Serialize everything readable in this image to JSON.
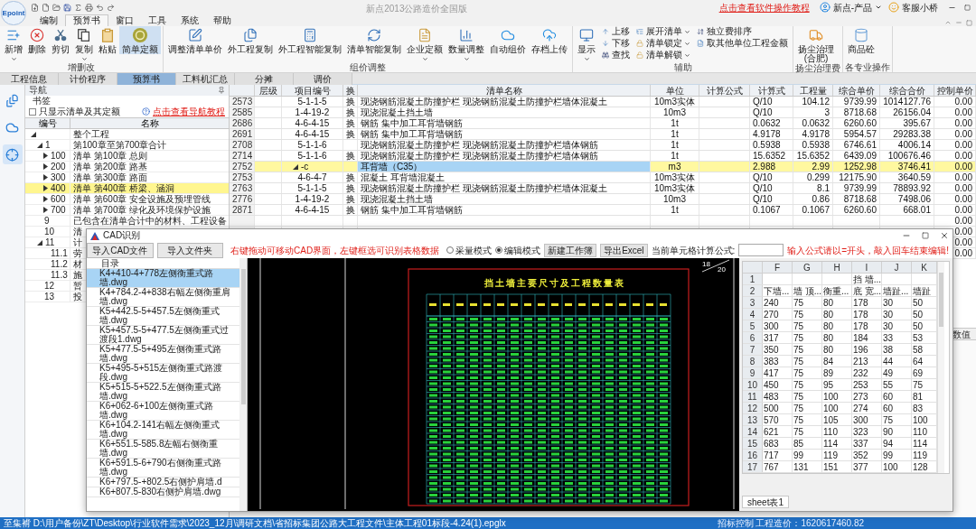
{
  "window": {
    "logo": "Epoint",
    "title": "新点2013公路造价全国版",
    "help_link": "点击查看软件操作教程",
    "user": "新点-产品",
    "service": "客服小桥"
  },
  "menu": [
    {
      "label": "编制",
      "selected": false
    },
    {
      "label": "预算书",
      "selected": true
    },
    {
      "label": "窗口",
      "selected": false
    },
    {
      "label": "工具",
      "selected": false
    },
    {
      "label": "系统",
      "selected": false
    },
    {
      "label": "帮助",
      "selected": false
    }
  ],
  "ribbon": {
    "groups": [
      {
        "label": "增删改",
        "buttons": [
          {
            "label": "新增",
            "kind": "large",
            "dropdown": true,
            "selected": false
          },
          {
            "label": "删除",
            "kind": "large",
            "dropdown": false,
            "selected": false
          },
          {
            "label": "剪切",
            "kind": "large",
            "dropdown": false,
            "selected": false
          },
          {
            "label": "复制",
            "kind": "large",
            "dropdown": true,
            "selected": false
          },
          {
            "label": "粘贴",
            "kind": "large",
            "dropdown": false,
            "selected": false
          },
          {
            "label": "简单定额",
            "kind": "large",
            "dropdown": false,
            "selected": true
          }
        ]
      },
      {
        "label": "组价调整",
        "buttons": [
          {
            "label": "调整清单单价",
            "kind": "large",
            "dropdown": false,
            "selected": false
          },
          {
            "label": "外工程复制",
            "kind": "large",
            "dropdown": false,
            "selected": false
          },
          {
            "label": "外工程智能复制",
            "kind": "large",
            "dropdown": false,
            "selected": false
          },
          {
            "label": "清单智能复制",
            "kind": "large",
            "dropdown": false,
            "selected": false
          },
          {
            "label": "企业定额",
            "kind": "large",
            "dropdown": true,
            "selected": false
          },
          {
            "label": "数量调整",
            "kind": "large",
            "dropdown": true,
            "selected": false
          },
          {
            "label": "自动组价",
            "kind": "large",
            "dropdown": false,
            "selected": false
          },
          {
            "label": "存档上传",
            "kind": "large",
            "dropdown": false,
            "selected": false
          }
        ]
      },
      {
        "label": "辅助",
        "buttons": [
          {
            "label": "显示",
            "kind": "large",
            "dropdown": true,
            "selected": false
          },
          {
            "label": "上移",
            "kind": "small",
            "dropdown": false,
            "selected": false
          },
          {
            "label": "下移",
            "kind": "small",
            "dropdown": false,
            "selected": false
          },
          {
            "label": "查找",
            "kind": "small",
            "dropdown": false,
            "selected": false
          },
          {
            "label": "展开清单",
            "kind": "small",
            "dropdown": true,
            "selected": false
          },
          {
            "label": "清单锁定",
            "kind": "small",
            "dropdown": true,
            "selected": false
          },
          {
            "label": "清单解锁",
            "kind": "small",
            "dropdown": true,
            "selected": false
          },
          {
            "label": "独立费排序",
            "kind": "small",
            "dropdown": false,
            "selected": false
          },
          {
            "label": "取其他单位工程金额",
            "kind": "small",
            "dropdown": false,
            "selected": false
          }
        ]
      },
      {
        "label": "扬尘治理费",
        "buttons": [
          {
            "label": "扬尘治理(合肥)",
            "kind": "large",
            "dropdown": false,
            "selected": false
          }
        ]
      },
      {
        "label": "各专业操作",
        "buttons": [
          {
            "label": "商品砼",
            "kind": "large",
            "dropdown": false,
            "selected": false
          }
        ]
      }
    ]
  },
  "view_tabs": [
    {
      "label": "工程信息",
      "selected": false
    },
    {
      "label": "计价程序",
      "selected": false
    },
    {
      "label": "预算书",
      "selected": true
    },
    {
      "label": "工料机汇总",
      "selected": false
    },
    {
      "label": "分摊",
      "selected": false
    },
    {
      "label": "调价",
      "selected": false
    }
  ],
  "side_icons": [
    {
      "selected": false
    },
    {
      "selected": false
    },
    {
      "selected": true
    }
  ],
  "navigator": {
    "title": "导航",
    "bookmark": "书签",
    "filter": {
      "label": "只显示清单及其定额",
      "checked": false
    },
    "help_link": "点击查看导航教程",
    "columns": [
      "编号",
      "名称"
    ],
    "tree": [
      {
        "name": "整个工程",
        "expanded": true,
        "selected": false,
        "children": [
          {
            "code": "1",
            "name": "第100章至第700章合计",
            "expanded": true,
            "selected": false,
            "children": [
              {
                "code": "100",
                "name": "清单 第100章 总则",
                "expanded": false,
                "selected": false
              },
              {
                "code": "200",
                "name": "清单 第200章 路基",
                "expanded": false,
                "selected": false
              },
              {
                "code": "300",
                "name": "清单 第300章 路面",
                "expanded": false,
                "selected": false
              },
              {
                "code": "400",
                "name": "清单 第400章 桥梁、涵洞",
                "expanded": false,
                "selected": true
              },
              {
                "code": "600",
                "name": "清单 第600章 安全设施及预埋管线",
                "expanded": false,
                "selected": false
              },
              {
                "code": "700",
                "name": "清单 第700章 绿化及环境保护设施",
                "expanded": false,
                "selected": false
              }
            ]
          },
          {
            "code": "9",
            "name": "已包含在清单合计中的材料、工程设备",
            "selected": false
          },
          {
            "code": "10",
            "name": "清",
            "selected": false
          },
          {
            "code": "11",
            "name": "计",
            "expanded": true,
            "selected": false,
            "children": [
              {
                "code": "11.1",
                "name": "劳",
                "selected": false
              },
              {
                "code": "11.2",
                "name": "材",
                "selected": false
              },
              {
                "code": "11.3",
                "name": "施",
                "selected": false
              }
            ]
          },
          {
            "code": "12",
            "name": "暂",
            "selected": false
          },
          {
            "code": "13",
            "name": "投",
            "selected": false
          }
        ]
      }
    ]
  },
  "table": {
    "columns": [
      "层级",
      "项目编号",
      "换",
      "清单名称",
      "单位",
      "计算公式",
      "计算式",
      "工程量",
      "综合单价",
      "综合合价",
      "控制单价"
    ],
    "rows": [
      {
        "no": "2573",
        "code": "5-1-1-5",
        "swap": "换",
        "name": "现浇钢筋混凝土防撞护栏 现浇钢筋混凝土防撞护栏墙体混凝土",
        "unit": "10m3实体",
        "calc": "Q/10",
        "quantity": "104.12",
        "unit_price": "9739.99",
        "total": "1014127.76",
        "control_price": "0.00",
        "selected": false
      },
      {
        "no": "2585",
        "code": "1-4-19-2",
        "swap": "换",
        "name": "现浇混凝土挡土墙",
        "unit": "10m3",
        "calc": "Q/10",
        "quantity": "3",
        "unit_price": "8718.68",
        "total": "26156.04",
        "control_price": "0.00",
        "selected": false
      },
      {
        "no": "2686",
        "code": "4-6-4-15",
        "swap": "换",
        "name": "钢筋 集中加工耳背墙钢筋",
        "unit": "1t",
        "calc": "0.0632",
        "quantity": "0.0632",
        "unit_price": "6260.60",
        "total": "395.67",
        "control_price": "0.00",
        "selected": false
      },
      {
        "no": "2691",
        "code": "4-6-4-15",
        "swap": "换",
        "name": "钢筋 集中加工耳背墙钢筋",
        "unit": "1t",
        "calc": "4.9178",
        "quantity": "4.9178",
        "unit_price": "5954.57",
        "total": "29283.38",
        "control_price": "0.00",
        "selected": false
      },
      {
        "no": "2708",
        "code": "5-1-1-6",
        "name": "现浇钢筋混凝土防撞护栏 现浇钢筋混凝土防撞护栏墙体钢筋",
        "unit": "1t",
        "calc": "0.5938",
        "quantity": "0.5938",
        "unit_price": "6746.61",
        "total": "4006.14",
        "control_price": "0.00",
        "selected": false
      },
      {
        "no": "2714",
        "code": "5-1-1-6",
        "swap": "换",
        "name": "现浇钢筋混凝土防撞护栏 现浇钢筋混凝土防撞护栏墙体钢筋",
        "unit": "1t",
        "calc": "15.6352",
        "quantity": "15.6352",
        "unit_price": "6439.09",
        "total": "100676.46",
        "control_price": "0.00",
        "selected": false
      },
      {
        "no": "2752",
        "code": "-c",
        "expanded": true,
        "name": "耳背墙（C35）",
        "unit": "m3",
        "calc": "2.988",
        "quantity": "2.99",
        "unit_price": "1252.98",
        "total": "3746.41",
        "control_price": "0.00",
        "selected": true
      },
      {
        "no": "2753",
        "code": "4-6-4-7",
        "swap": "换",
        "name": "混凝土 耳背墙混凝土",
        "unit": "10m3实体",
        "calc": "Q/10",
        "quantity": "0.299",
        "unit_price": "12175.90",
        "total": "3640.59",
        "control_price": "0.00",
        "selected": false
      },
      {
        "no": "2763",
        "code": "5-1-1-5",
        "swap": "换",
        "name": "现浇钢筋混凝土防撞护栏 现浇钢筋混凝土防撞护栏墙体混凝土",
        "unit": "10m3实体",
        "calc": "Q/10",
        "quantity": "8.1",
        "unit_price": "9739.99",
        "total": "78893.92",
        "control_price": "0.00",
        "selected": false
      },
      {
        "no": "2776",
        "code": "1-4-19-2",
        "swap": "换",
        "name": "现浇混凝土挡土墙",
        "unit": "10m3",
        "calc": "Q/10",
        "quantity": "0.86",
        "unit_price": "8718.68",
        "total": "7498.06",
        "control_price": "0.00",
        "selected": false
      },
      {
        "no": "2871",
        "code": "4-6-4-15",
        "swap": "换",
        "name": "钢筋 集中加工耳背墙钢筋",
        "unit": "1t",
        "calc": "0.1067",
        "quantity": "0.1067",
        "unit_price": "6260.60",
        "total": "668.01",
        "control_price": "0.00",
        "selected": false
      },
      {
        "control_price": "0.00",
        "selected": false
      },
      {
        "control_price": "0.00",
        "selected": false
      },
      {
        "control_price": "0.00",
        "selected": false
      },
      {
        "control_price": "0.00",
        "selected": false
      }
    ]
  },
  "lower_panel": {
    "column": "数值"
  },
  "cad_dialog": {
    "title": "CAD识别",
    "import_file": "导入CAD文件",
    "import_folder": "导入文件夹",
    "hint": "右键拖动可移动CAD界面，左键框选可识别表格数据",
    "modes": [
      {
        "label": "采量模式",
        "selected": false
      },
      {
        "label": "编辑模式",
        "selected": true
      }
    ],
    "new_workbook": "新建工作簿",
    "export": "导出Excel",
    "formula_label": "当前单元格计算公式:",
    "formula_hint": "输入公式请以=开头，敲入回车结束编辑!",
    "files_header": "目录",
    "files": [
      {
        "name": "K4+410-4+778左侧衡重式路墙.dwg",
        "selected": true
      },
      {
        "name": "K4+784.2-4+838右幅左侧衡重肩墙.dwg",
        "selected": false
      },
      {
        "name": "K5+442.5-5+457.5左侧衡重式墙.dwg",
        "selected": false
      },
      {
        "name": "K5+457.5-5+477.5左侧衡重式过渡段1.dwg",
        "selected": false
      },
      {
        "name": "K5+477.5-5+495左侧衡重式路墙.dwg",
        "selected": false
      },
      {
        "name": "K5+495-5+515左侧衡重式路渡段.dwg",
        "selected": false
      },
      {
        "name": "K5+515-5+522.5左侧衡重式路墙.dwg",
        "selected": false
      },
      {
        "name": "K6+062-6+100左侧衡重式路墙.dwg",
        "selected": false
      },
      {
        "name": "K6+104.2-141右幅左侧衡重式墙.dwg",
        "selected": false
      },
      {
        "name": "K6+551.5-585.8左幅右侧衡重墙.dwg",
        "selected": false
      },
      {
        "name": "K6+591.5-6+790右侧衡重式路墙.dwg",
        "selected": false
      },
      {
        "name": "K6+797.5-+802.5右侧护肩墙.d",
        "selected": false
      },
      {
        "name": "K6+807.5-830右侧护肩墙.dwg",
        "selected": false
      }
    ],
    "drawing_title": "挡土墙主要尺寸及工程数量表",
    "page_current": "18",
    "page_total": "20",
    "sheet": {
      "columns": [
        "F",
        "G",
        "H",
        "I",
        "J",
        "K"
      ],
      "tab": "sheet表1",
      "rows": [
        {
          "n": "1",
          "cells": [
            null,
            null,
            null,
            "挡 墙...",
            null,
            null
          ]
        },
        {
          "n": "2",
          "cells": [
            "下墙...",
            "墙 顶...",
            "衡重...",
            "底 宽...",
            "墙趾...",
            "墙趾"
          ]
        },
        {
          "n": "3",
          "cells": [
            "240",
            "75",
            "80",
            "178",
            "30",
            "50"
          ]
        },
        {
          "n": "4",
          "cells": [
            "270",
            "75",
            "80",
            "178",
            "30",
            "50"
          ]
        },
        {
          "n": "5",
          "cells": [
            "300",
            "75",
            "80",
            "178",
            "30",
            "50"
          ]
        },
        {
          "n": "6",
          "cells": [
            "317",
            "75",
            "80",
            "184",
            "33",
            "53"
          ]
        },
        {
          "n": "7",
          "cells": [
            "350",
            "75",
            "80",
            "196",
            "38",
            "58"
          ]
        },
        {
          "n": "8",
          "cells": [
            "383",
            "75",
            "84",
            "213",
            "44",
            "64"
          ]
        },
        {
          "n": "9",
          "cells": [
            "417",
            "75",
            "89",
            "232",
            "49",
            "69"
          ]
        },
        {
          "n": "10",
          "cells": [
            "450",
            "75",
            "95",
            "253",
            "55",
            "75"
          ]
        },
        {
          "n": "11",
          "cells": [
            "483",
            "75",
            "100",
            "273",
            "60",
            "81"
          ]
        },
        {
          "n": "12",
          "cells": [
            "500",
            "75",
            "100",
            "274",
            "60",
            "83"
          ]
        },
        {
          "n": "13",
          "cells": [
            "570",
            "75",
            "105",
            "300",
            "75",
            "100"
          ]
        },
        {
          "n": "14",
          "cells": [
            "621",
            "75",
            "110",
            "323",
            "90",
            "110"
          ]
        },
        {
          "n": "15",
          "cells": [
            "683",
            "85",
            "114",
            "337",
            "94",
            "114"
          ]
        },
        {
          "n": "16",
          "cells": [
            "717",
            "99",
            "119",
            "352",
            "99",
            "119"
          ]
        },
        {
          "n": "17",
          "cells": [
            "767",
            "131",
            "151",
            "377",
            "100",
            "128"
          ]
        }
      ]
    }
  },
  "status_bar": {
    "path": "至集褙 D:\\用户备份\\ZT\\Desktop\\行业软件需求\\2023_12月\\调研文档\\省招标集团公路大工程文件\\主体工程01标段-4.24(1).epglx",
    "cost": "招标控制 工程造价：1620617460.82"
  }
}
